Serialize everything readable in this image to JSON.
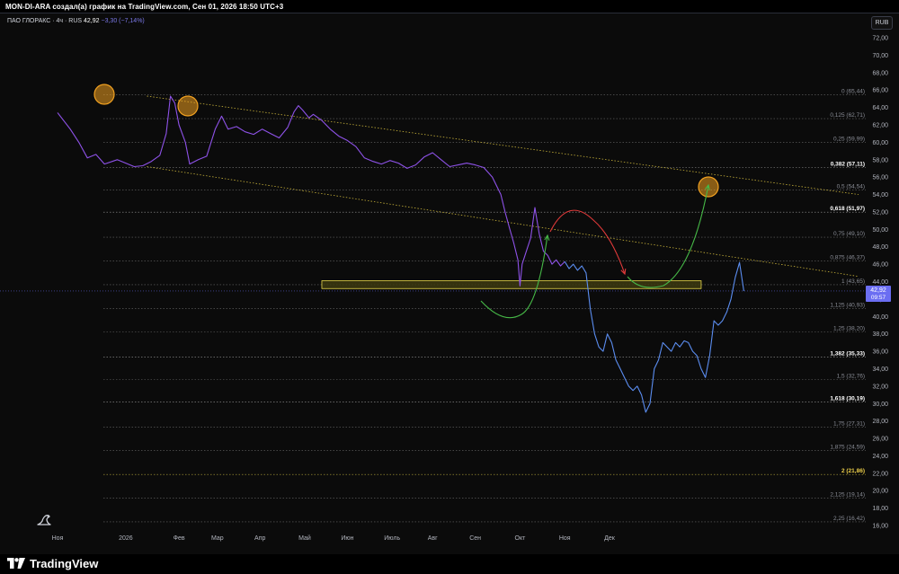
{
  "header": {
    "credit": "MON-DI-ARA создал(а) график на TradingView.com, Сен 01, 2026 18:50 UTC+3"
  },
  "symbol": {
    "name": "ПАО ГЛОРАКС · 4ч · RUS",
    "last": "42,92",
    "change": "−3,30 (−7,14%)"
  },
  "currency": "RUB",
  "price_label": {
    "value": "42,92",
    "countdown": "09:57"
  },
  "footer": {
    "brand": "TradingView"
  },
  "colors": {
    "background": "#0b0b0b",
    "price_line_early": "#8e52e8",
    "price_line_late": "#5b8df0",
    "zone_fill": "#3d3a10",
    "zone_border": "#e6d64a",
    "trend_line": "#c8b23a",
    "marker_circle": "#f0a020",
    "arrow_up": "#46b847",
    "arrow_down": "#e03a3a",
    "price_badge": "#6b6ef2"
  },
  "chart_data": {
    "type": "line",
    "ylim": [
      14,
      74
    ],
    "y_ticks": [
      "72,00",
      "70,00",
      "68,00",
      "66,00",
      "64,00",
      "62,00",
      "60,00",
      "58,00",
      "56,00",
      "54,00",
      "52,00",
      "50,00",
      "48,00",
      "46,00",
      "44,00",
      "42,00",
      "40,00",
      "38,00",
      "36,00",
      "34,00",
      "32,00",
      "30,00",
      "28,00",
      "26,00",
      "24,00",
      "22,00",
      "20,00",
      "18,00",
      "16,00"
    ],
    "x_ticks": [
      "Ноя",
      "2026",
      "Фев",
      "Мар",
      "Апр",
      "Май",
      "Июн",
      "Июль",
      "Авг",
      "Сен",
      "Окт",
      "Ноя",
      "Дек"
    ],
    "fib_levels": [
      {
        "label": "0 (65,44)",
        "value": 65.44,
        "bold": false
      },
      {
        "label": "0,125 (62,71)",
        "value": 62.71,
        "bold": false
      },
      {
        "label": "0,25 (59,99)",
        "value": 59.99,
        "bold": false
      },
      {
        "label": "0,382 (57,11)",
        "value": 57.11,
        "bold": true
      },
      {
        "label": "0,5 (54,54)",
        "value": 54.54,
        "bold": false
      },
      {
        "label": "0,618 (51,97)",
        "value": 51.97,
        "bold": true
      },
      {
        "label": "0,75 (49,10)",
        "value": 49.1,
        "bold": false
      },
      {
        "label": "0,875 (46,37)",
        "value": 46.37,
        "bold": false
      },
      {
        "label": "1 (43,65)",
        "value": 43.65,
        "bold": false
      },
      {
        "label": "1,125 (40,93)",
        "value": 40.93,
        "bold": false
      },
      {
        "label": "1,25 (38,20)",
        "value": 38.2,
        "bold": false
      },
      {
        "label": "1,382 (35,33)",
        "value": 35.33,
        "bold": true
      },
      {
        "label": "1,5 (32,76)",
        "value": 32.76,
        "bold": false
      },
      {
        "label": "1,618 (30,19)",
        "value": 30.19,
        "bold": true
      },
      {
        "label": "1,75 (27,31)",
        "value": 27.31,
        "bold": false
      },
      {
        "label": "1,875 (24,59)",
        "value": 24.59,
        "bold": false
      },
      {
        "label": "2 (21,86)",
        "value": 21.86,
        "bold": true,
        "highlight": true
      },
      {
        "label": "2,125 (19,14)",
        "value": 19.14,
        "bold": false
      },
      {
        "label": "2,25 (16,42)",
        "value": 16.42,
        "bold": false
      }
    ],
    "series": [
      {
        "values": [
          [
            0,
            63.4
          ],
          [
            0.3,
            61.5
          ],
          [
            0.5,
            60.0
          ],
          [
            0.7,
            58.2
          ],
          [
            0.9,
            58.6
          ],
          [
            1.1,
            57.5
          ],
          [
            1.4,
            58.0
          ],
          [
            1.6,
            57.6
          ],
          [
            1.8,
            57.2
          ],
          [
            2.0,
            57.3
          ],
          [
            2.2,
            57.8
          ],
          [
            2.4,
            58.5
          ],
          [
            2.55,
            61.0
          ],
          [
            2.65,
            65.3
          ],
          [
            2.75,
            64.5
          ],
          [
            2.85,
            62.0
          ],
          [
            3.0,
            60.0
          ],
          [
            3.1,
            57.5
          ],
          [
            3.3,
            58.0
          ],
          [
            3.5,
            58.4
          ],
          [
            3.7,
            61.5
          ],
          [
            3.85,
            63.0
          ],
          [
            4.0,
            61.5
          ],
          [
            4.2,
            61.8
          ],
          [
            4.4,
            61.2
          ],
          [
            4.6,
            60.9
          ],
          [
            4.8,
            61.5
          ],
          [
            5.0,
            61.0
          ],
          [
            5.2,
            60.5
          ],
          [
            5.4,
            61.7
          ],
          [
            5.55,
            63.5
          ],
          [
            5.65,
            64.2
          ],
          [
            5.75,
            63.7
          ],
          [
            5.9,
            62.8
          ],
          [
            6.0,
            63.2
          ],
          [
            6.2,
            62.5
          ],
          [
            6.4,
            61.5
          ],
          [
            6.6,
            60.7
          ],
          [
            6.8,
            60.2
          ],
          [
            7.0,
            59.5
          ],
          [
            7.2,
            58.2
          ],
          [
            7.4,
            57.8
          ],
          [
            7.6,
            57.5
          ],
          [
            7.8,
            57.9
          ],
          [
            8.0,
            57.6
          ],
          [
            8.2,
            57.0
          ],
          [
            8.4,
            57.4
          ],
          [
            8.6,
            58.3
          ],
          [
            8.8,
            58.8
          ],
          [
            9.0,
            58.0
          ],
          [
            9.2,
            57.2
          ],
          [
            9.4,
            57.4
          ],
          [
            9.6,
            57.6
          ],
          [
            9.8,
            57.4
          ],
          [
            10.0,
            57.1
          ],
          [
            10.2,
            56.0
          ],
          [
            10.4,
            54.0
          ],
          [
            10.5,
            52.0
          ],
          [
            10.6,
            50.2
          ],
          [
            10.7,
            48.5
          ],
          [
            10.8,
            46.5
          ],
          [
            10.85,
            43.5
          ],
          [
            10.9,
            46.0
          ],
          [
            11.0,
            47.5
          ],
          [
            11.1,
            49.0
          ],
          [
            11.2,
            52.5
          ],
          [
            11.3,
            49.5
          ],
          [
            11.4,
            47.5
          ],
          [
            11.5,
            47.0
          ],
          [
            11.6,
            46.0
          ],
          [
            11.7,
            46.5
          ],
          [
            11.8,
            45.8
          ],
          [
            11.9,
            46.3
          ],
          [
            12.0,
            45.5
          ],
          [
            12.1,
            46.0
          ],
          [
            12.2,
            45.3
          ],
          [
            12.3,
            45.8
          ],
          [
            12.4,
            45.0
          ],
          [
            12.5,
            40.8
          ],
          [
            12.6,
            38.0
          ],
          [
            12.7,
            36.5
          ],
          [
            12.8,
            36.0
          ],
          [
            12.9,
            38.0
          ],
          [
            13.0,
            37.0
          ],
          [
            13.1,
            35.0
          ],
          [
            13.2,
            34.0
          ],
          [
            13.3,
            33.0
          ],
          [
            13.4,
            32.0
          ],
          [
            13.5,
            31.5
          ],
          [
            13.6,
            32.0
          ],
          [
            13.7,
            31.0
          ],
          [
            13.8,
            29.0
          ],
          [
            13.9,
            30.0
          ],
          [
            14.0,
            34.0
          ],
          [
            14.1,
            35.0
          ],
          [
            14.2,
            37.0
          ],
          [
            14.3,
            36.5
          ],
          [
            14.4,
            36.0
          ],
          [
            14.5,
            37.0
          ],
          [
            14.6,
            36.5
          ],
          [
            14.7,
            37.2
          ],
          [
            14.8,
            37.0
          ],
          [
            14.9,
            36.0
          ],
          [
            15.0,
            35.5
          ],
          [
            15.1,
            34.0
          ],
          [
            15.2,
            33.0
          ],
          [
            15.3,
            35.5
          ],
          [
            15.4,
            39.5
          ],
          [
            15.5,
            39.0
          ],
          [
            15.6,
            39.5
          ],
          [
            15.7,
            40.5
          ],
          [
            15.8,
            42.0
          ],
          [
            15.9,
            44.5
          ],
          [
            16.0,
            46.2
          ],
          [
            16.1,
            42.92
          ]
        ]
      }
    ],
    "x_tick_positions": [
      0,
      1.6,
      2.85,
      3.75,
      4.75,
      5.8,
      6.8,
      7.85,
      8.8,
      9.8,
      10.85,
      11.9,
      12.95
    ],
    "annotations": {
      "markers": [
        [
          1.0,
          65.3
        ],
        [
          2.95,
          64.0
        ],
        [
          14.5,
          55.0
        ]
      ],
      "trendline_upper": [
        [
          1.0,
          65.3
        ],
        [
          16.7,
          54.0
        ]
      ],
      "trendline_lower": [
        [
          1.0,
          57.2
        ],
        [
          16.7,
          44.6
        ]
      ],
      "zone": {
        "from": 43.2,
        "to": 44.1,
        "x0": 6.2,
        "x1": 15.1
      }
    }
  }
}
